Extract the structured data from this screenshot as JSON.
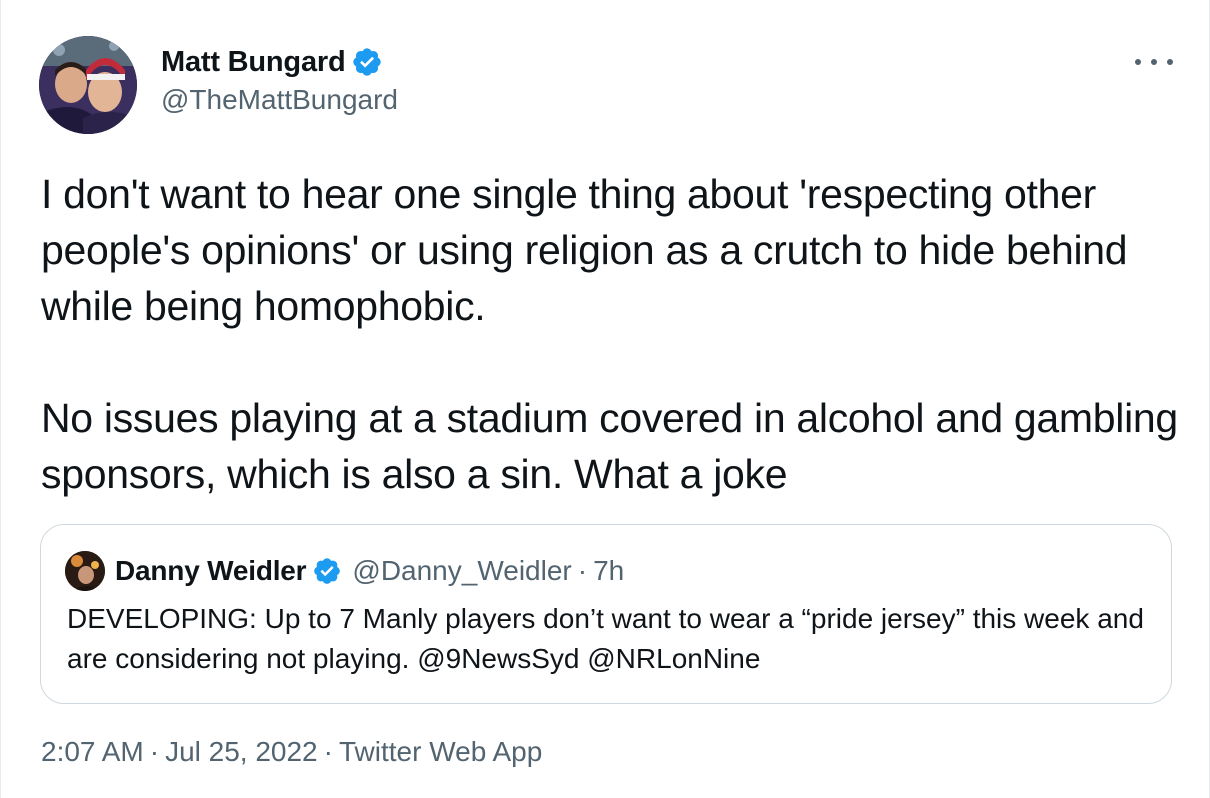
{
  "tweet": {
    "author": {
      "display_name": "Matt Bungard",
      "handle": "@TheMattBungard",
      "verified_icon": "verified-badge-icon",
      "avatar_icon": "avatar-photo"
    },
    "more_icon": "more-dots-icon",
    "text_paragraph_1": "I don't want to hear one single thing about 'respecting other people's opinions' or using religion as a crutch to hide behind while being homophobic.",
    "text_paragraph_2": "No issues playing at a stadium covered in alcohol and gambling sponsors, which is also a sin. What a joke",
    "quoted": {
      "display_name": "Danny Weidler",
      "handle": "@Danny_Weidler",
      "separator": "·",
      "time": "7h",
      "text": "DEVELOPING: Up to 7 Manly players don’t want to wear a “pride jersey” this week and are considering not playing.  @9NewsSyd @NRLonNine"
    },
    "meta": {
      "time": "2:07 AM",
      "separator_1": "·",
      "date": "Jul 25, 2022",
      "separator_2": "·",
      "source": "Twitter Web App"
    }
  },
  "colors": {
    "text_primary": "#0f1419",
    "text_secondary": "#536471",
    "verified_blue": "#1d9bf0",
    "border": "#cfd9de"
  }
}
